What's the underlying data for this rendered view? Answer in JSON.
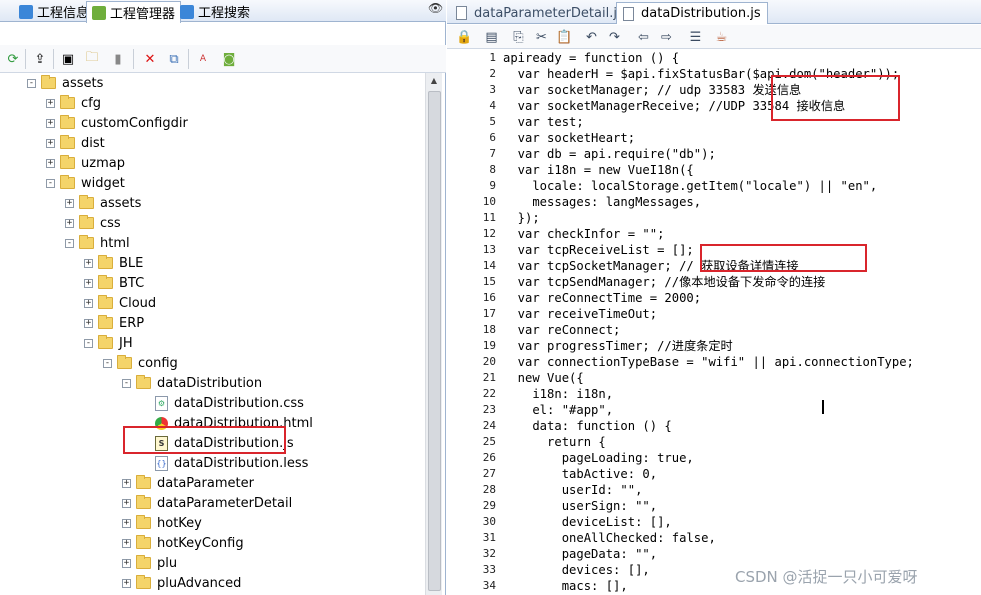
{
  "left_panel": {
    "tabs": [
      {
        "label": "工程信息",
        "icon": "info-icon",
        "active": false
      },
      {
        "label": "工程管理器",
        "icon": "android-icon",
        "active": true
      },
      {
        "label": "工程搜索",
        "icon": "search-icon",
        "active": false
      }
    ],
    "toolbar_icons": [
      "refresh-icon",
      "upload-icon",
      "terminal-icon",
      "folder-search-icon",
      "book-icon",
      "delete-icon",
      "copy-window-icon",
      "pdf-icon",
      "android-icon"
    ],
    "tree": [
      {
        "label": "assets",
        "type": "folder",
        "level": 0,
        "expand": "-"
      },
      {
        "label": "cfg",
        "type": "folder",
        "level": 1,
        "expand": "+"
      },
      {
        "label": "customConfigdir",
        "type": "folder",
        "level": 1,
        "expand": "+"
      },
      {
        "label": "dist",
        "type": "folder",
        "level": 1,
        "expand": "+"
      },
      {
        "label": "uzmap",
        "type": "folder",
        "level": 1,
        "expand": "+"
      },
      {
        "label": "widget",
        "type": "folder",
        "level": 1,
        "expand": "-"
      },
      {
        "label": "assets",
        "type": "folder",
        "level": 2,
        "expand": "+"
      },
      {
        "label": "css",
        "type": "folder",
        "level": 2,
        "expand": "+"
      },
      {
        "label": "html",
        "type": "folder",
        "level": 2,
        "expand": "-"
      },
      {
        "label": "BLE",
        "type": "folder",
        "level": 3,
        "expand": "+"
      },
      {
        "label": "BTC",
        "type": "folder",
        "level": 3,
        "expand": "+"
      },
      {
        "label": "Cloud",
        "type": "folder",
        "level": 3,
        "expand": "+"
      },
      {
        "label": "ERP",
        "type": "folder",
        "level": 3,
        "expand": "+"
      },
      {
        "label": "JH",
        "type": "folder",
        "level": 3,
        "expand": "-"
      },
      {
        "label": "config",
        "type": "folder",
        "level": 4,
        "expand": "-"
      },
      {
        "label": "dataDistribution",
        "type": "folder",
        "level": 5,
        "expand": "-"
      },
      {
        "label": "dataDistribution.css",
        "type": "css",
        "level": 6,
        "expand": ""
      },
      {
        "label": "dataDistribution.html",
        "type": "html",
        "level": 6,
        "expand": ""
      },
      {
        "label": "dataDistribution.js",
        "type": "js",
        "level": 6,
        "expand": "",
        "highlighted": true
      },
      {
        "label": "dataDistribution.less",
        "type": "less",
        "level": 6,
        "expand": ""
      },
      {
        "label": "dataParameter",
        "type": "folder",
        "level": 5,
        "expand": "+"
      },
      {
        "label": "dataParameterDetail",
        "type": "folder",
        "level": 5,
        "expand": "+"
      },
      {
        "label": "hotKey",
        "type": "folder",
        "level": 5,
        "expand": "+"
      },
      {
        "label": "hotKeyConfig",
        "type": "folder",
        "level": 5,
        "expand": "+"
      },
      {
        "label": "plu",
        "type": "folder",
        "level": 5,
        "expand": "+"
      },
      {
        "label": "pluAdvanced",
        "type": "folder",
        "level": 5,
        "expand": "+"
      }
    ]
  },
  "editor": {
    "tabs": [
      {
        "label": "dataParameterDetail.js",
        "active": false
      },
      {
        "label": "dataDistribution.js",
        "active": true
      }
    ],
    "toolbar_icons": [
      "lock-icon",
      "save-icon",
      "copy-icon",
      "cut-icon",
      "paste-icon",
      "undo-icon",
      "redo-icon",
      "back-icon",
      "forward-icon",
      "format-icon",
      "java-icon"
    ],
    "lines": [
      {
        "n": "1",
        "text": "apiready = function () {"
      },
      {
        "n": "2",
        "text": "  var headerH = $api.fixStatusBar($api.dom(\"header\"));"
      },
      {
        "n": "3",
        "text": "  var socketManager; // udp 33583 发送信息"
      },
      {
        "n": "4",
        "text": "  var socketManagerReceive; //UDP 33584 接收信息"
      },
      {
        "n": "5",
        "text": "  var test;"
      },
      {
        "n": "6",
        "text": "  var socketHeart;"
      },
      {
        "n": "7",
        "text": "  var db = api.require(\"db\");"
      },
      {
        "n": "8",
        "text": "  var i18n = new VueI18n({"
      },
      {
        "n": "9",
        "text": "    locale: localStorage.getItem(\"locale\") || \"en\","
      },
      {
        "n": "10",
        "text": "    messages: langMessages,"
      },
      {
        "n": "11",
        "text": "  });"
      },
      {
        "n": "12",
        "text": "  var checkInfor = \"\";"
      },
      {
        "n": "13",
        "text": "  var tcpReceiveList = [];"
      },
      {
        "n": "14",
        "text": "  var tcpSocketManager; // 获取设备详情连接"
      },
      {
        "n": "15",
        "text": "  var tcpSendManager; //像本地设备下发命令的连接"
      },
      {
        "n": "16",
        "text": "  var reConnectTime = 2000;"
      },
      {
        "n": "17",
        "text": "  var receiveTimeOut;"
      },
      {
        "n": "18",
        "text": "  var reConnect;"
      },
      {
        "n": "19",
        "text": "  var progressTimer; //进度条定时"
      },
      {
        "n": "20",
        "text": "  var connectionTypeBase = \"wifi\" || api.connectionType;"
      },
      {
        "n": "21",
        "text": "  new Vue({"
      },
      {
        "n": "22",
        "text": "    i18n: i18n,"
      },
      {
        "n": "23",
        "text": "    el: \"#app\","
      },
      {
        "n": "24",
        "text": "    data: function () {"
      },
      {
        "n": "25",
        "text": "      return {"
      },
      {
        "n": "26",
        "text": "        pageLoading: true,"
      },
      {
        "n": "27",
        "text": "        tabActive: 0,"
      },
      {
        "n": "28",
        "text": "        userId: \"\","
      },
      {
        "n": "29",
        "text": "        userSign: \"\","
      },
      {
        "n": "30",
        "text": "        deviceList: [],"
      },
      {
        "n": "31",
        "text": "        oneAllChecked: false,"
      },
      {
        "n": "32",
        "text": "        pageData: \"\","
      },
      {
        "n": "33",
        "text": "        devices: [],"
      },
      {
        "n": "34",
        "text": "        macs: [],"
      }
    ]
  },
  "watermark": "CSDN @活捉一只小可爱呀",
  "colors": {
    "highlight_box": "#d9252c",
    "tab_border": "#9fb4d0"
  }
}
